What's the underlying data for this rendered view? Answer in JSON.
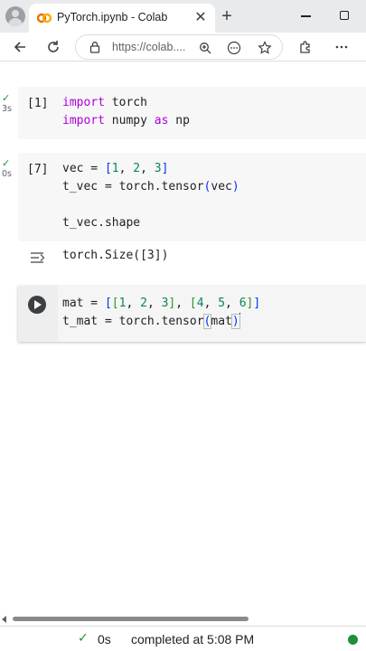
{
  "browser": {
    "tab_title": "PyTorch.ipynb - Colab",
    "url": "https://colab....",
    "icons": [
      "profile-icon",
      "colab-logo-icon",
      "close-icon",
      "plus-icon",
      "minimize-icon",
      "maximize-icon",
      "back-arrow-icon",
      "reload-icon",
      "lock-icon",
      "zoom-icon",
      "more-horizontal-icon",
      "star-icon",
      "extensions-icon",
      "more-vertical-icon"
    ]
  },
  "cells": [
    {
      "check": "✓",
      "time": "3s",
      "prompt": "[1]",
      "line1": {
        "kw1": "import",
        "t1": " torch"
      },
      "line2": {
        "kw1": "import",
        "t1": " numpy ",
        "kw2": "as",
        "t2": " np"
      }
    },
    {
      "check": "✓",
      "time": "0s",
      "prompt": "[7]",
      "line1": {
        "a": "vec = ",
        "b1": "[",
        "n1": "1",
        "c1": ", ",
        "n2": "2",
        "c2": ", ",
        "n3": "3",
        "b2": "]"
      },
      "line2": {
        "a": "t_vec = torch.tensor",
        "b1": "(",
        "m": "vec",
        "b2": ")"
      },
      "line4": "t_vec.shape",
      "output": "torch.Size([3])"
    },
    {
      "line1": {
        "a": "mat = ",
        "o1": "[",
        "o2": "[",
        "n1": "1",
        "s1": ", ",
        "n2": "2",
        "s2": ", ",
        "n3": "3",
        "c2": "]",
        "s3": ", ",
        "o3": "[",
        "n4": "4",
        "s4": ", ",
        "n5": "5",
        "s5": ", ",
        "n6": "6",
        "c3": "]",
        "c1": "]"
      },
      "line2": {
        "a": "t_mat = torch.tensor",
        "b1": "(",
        "m": "mat",
        "b2": ")"
      }
    }
  ],
  "status": {
    "check": "✓",
    "time": "0s",
    "completed": "completed at 5:08 PM",
    "dot_color": "#1e8e3e"
  }
}
